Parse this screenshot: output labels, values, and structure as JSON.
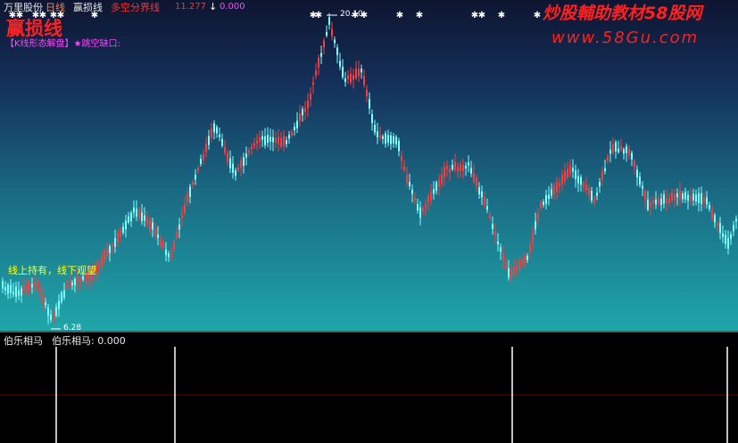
{
  "header": {
    "stock_name": "万里股份",
    "period": "日线",
    "indicator_name": "赢损线",
    "line_label": "多空分界线",
    "line_value": "11.277",
    "arrow_value": "0.000"
  },
  "overlay": {
    "big_title": "赢损线",
    "tags": "【K线形态解盘】★跳空缺口:",
    "note": "线上持有，线下观望",
    "high_label": "20.10",
    "low_label": "6.28"
  },
  "watermark": {
    "line1": "炒股輔助教材58股网",
    "line2": "www.58Gu.com"
  },
  "sub_panel": {
    "name": "伯乐相马",
    "value_label": "伯乐相马: 0.000"
  },
  "colors": {
    "up": "#ff3b3b",
    "down": "#7fffff",
    "marker": "#ffffff",
    "note": "#ffff00",
    "tags": "#ff44ff",
    "big_title": "#ff2020",
    "value": "#ff3030"
  },
  "chart_data": [
    {
      "type": "candlestick",
      "price_range": [
        6.28,
        20.1
      ],
      "markers": "white diamonds along the top",
      "annotations": [
        "20.10",
        "6.28"
      ]
    },
    {
      "type": "bar",
      "title": "伯乐相马",
      "value": 0.0,
      "signal_count": 4
    }
  ]
}
